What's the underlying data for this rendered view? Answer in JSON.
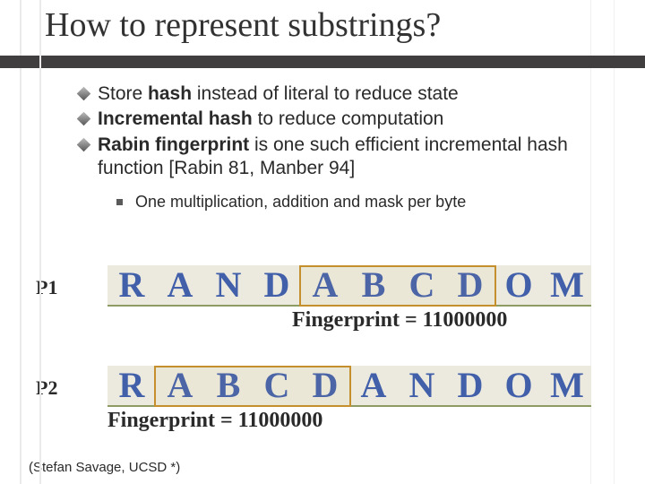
{
  "title": "How to represent substrings?",
  "bullets": {
    "b1_pre": "Store ",
    "b1_bold": "hash",
    "b1_post": " instead of literal to reduce state",
    "b2_bold": "Incremental hash",
    "b2_post": " to reduce computation",
    "b3_bold": "Rabin fingerprint",
    "b3_post": " is one such efficient incremental hash function [Rabin 81, Manber 94]",
    "sub1": "One multiplication, addition and mask per byte"
  },
  "seq": {
    "p1_label": "P1",
    "p1_chars": [
      "R",
      "A",
      "N",
      "D",
      "A",
      "B",
      "C",
      "D",
      "O",
      "M"
    ],
    "p1_caption": "Fingerprint = 11000000",
    "p2_label": "P2",
    "p2_chars": [
      "R",
      "A",
      "B",
      "C",
      "D",
      "A",
      "N",
      "D",
      "O",
      "M"
    ],
    "p2_caption": "Fingerprint = 11000000"
  },
  "footer": "(Stefan Savage, UCSD *)"
}
